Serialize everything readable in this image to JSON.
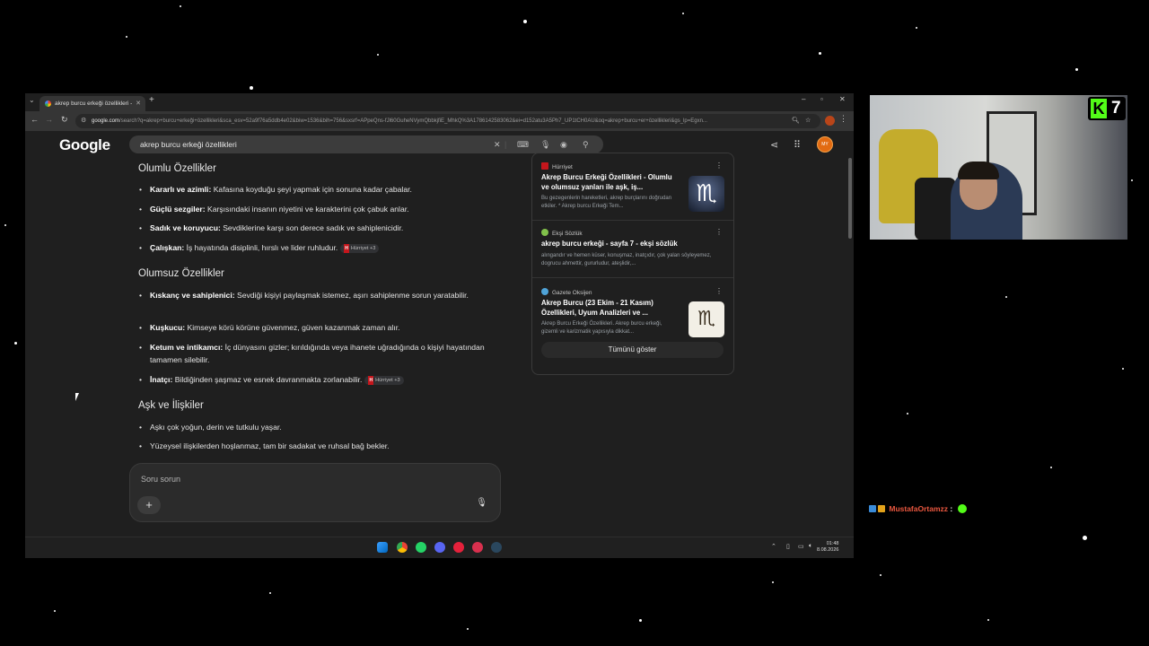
{
  "browser": {
    "tab_title": "akrep burcu erkeği özellikleri -",
    "url_host": "google.com",
    "url_rest": "/search?q=akrep+burcu+erkeği+özellikleri&sca_esv=52a9f76a5ddb4e02&biw=1536&bih=756&sxsrf=APpeQns-fJl60GuheNVymQbbkjfiE_MhkQ%3A1786142583062&ei=d152atu3A5Ph7_UP1tCH0AU&oq=akrep+burcu+er+özellikleri&gs_lp=Egxn...",
    "new_tab": "+",
    "minimize": "–",
    "maximize": "▫",
    "close": "✕"
  },
  "google": {
    "logo": "Google",
    "query": "akrep burcu erkeği özellikleri"
  },
  "answer": {
    "sections": [
      {
        "heading": "Olumlu Özellikler",
        "items": [
          {
            "bold": "Kararlı ve azimli:",
            "text": " Kafasına koyduğu şeyi yapmak için sonuna kadar çabalar.",
            "chip": ""
          },
          {
            "bold": "Güçlü sezgiler:",
            "text": " Karşısındaki insanın niyetini ve karakterini çok çabuk anlar.",
            "chip": ""
          },
          {
            "bold": "Sadık ve koruyucu:",
            "text": " Sevdiklerine karşı son derece sadık ve sahiplenicidir.",
            "chip": ""
          },
          {
            "bold": "Çalışkan:",
            "text": " İş hayatında disiplinli, hırslı ve lider ruhludur.",
            "chip": "Hürriyet +3"
          }
        ]
      },
      {
        "heading": "Olumsuz Özellikler",
        "items": [
          {
            "bold": "Kıskanç ve sahiplenici:",
            "text": " Sevdiği kişiyi paylaşmak istemez, aşırı sahiplenme sorun yaratabilir.",
            "chip": ""
          },
          {
            "bold": "Kuşkucu:",
            "text": " Kimseye körü körüne güvenmez, güven kazanmak zaman alır.",
            "chip": ""
          },
          {
            "bold": "Ketum ve intikamcı:",
            "text": " İç dünyasını gizler; kırıldığında veya ihanete uğradığında o kişiyi hayatından tamamen silebilir.",
            "chip": ""
          },
          {
            "bold": "İnatçı:",
            "text": " Bildiğinden şaşmaz ve esnek davranmakta zorlanabilir.",
            "chip": "Hürriyet +3"
          }
        ]
      },
      {
        "heading": "Aşk ve İlişkiler",
        "items": [
          {
            "bold": "",
            "text": "Aşkı çok yoğun, derin ve tutkulu yaşar.",
            "chip": ""
          },
          {
            "bold": "",
            "text": "Yüzeysel ilişkilerden hoşlanmaz, tam bir sadakat ve ruhsal bağ bekler.",
            "chip": ""
          }
        ]
      }
    ],
    "ask_placeholder": "Soru sorun",
    "plus": "+"
  },
  "sources": [
    {
      "site": "Hürriyet",
      "title": "Akrep Burcu Erkeği Özellikleri - Olumlu ve olumsuz yanları ile aşk, iş...",
      "snippet": "Bu gezegenlerin hareketleri, akrep burçlarını doğrudan etkiler. * Akrep burcu Erkeği Tem...",
      "color": "#c4161c"
    },
    {
      "site": "Ekşi Sözlük",
      "title": "akrep burcu erkeği - sayfa 7 - ekşi sözlük",
      "snippet": "alıngandır ve hemen küser, konuşmaz, inatçıdır, çok yalan söyleyemez, dogrucu ahmettir, gururludur, ateşlidir,...",
      "color": "#81c14b"
    },
    {
      "site": "Gazete Oksijen",
      "title": "Akrep Burcu (23 Ekim - 21 Kasım) Özellikleri, Uyum Analizleri ve ...",
      "snippet": "Akrep Burcu Erkeği Özellikleri. Akrep burcu erkeği, gizemli ve karizmatik yapısıyla dikkat...",
      "color": "#4fa3d8"
    }
  ],
  "show_all": "Tümünü göster",
  "taskbar": {
    "time": "01:48",
    "date": "8.08.2026"
  },
  "stream": {
    "kick_number": "7",
    "chat_user": "MustafaOrtamzz",
    "chat_sep": ":"
  }
}
